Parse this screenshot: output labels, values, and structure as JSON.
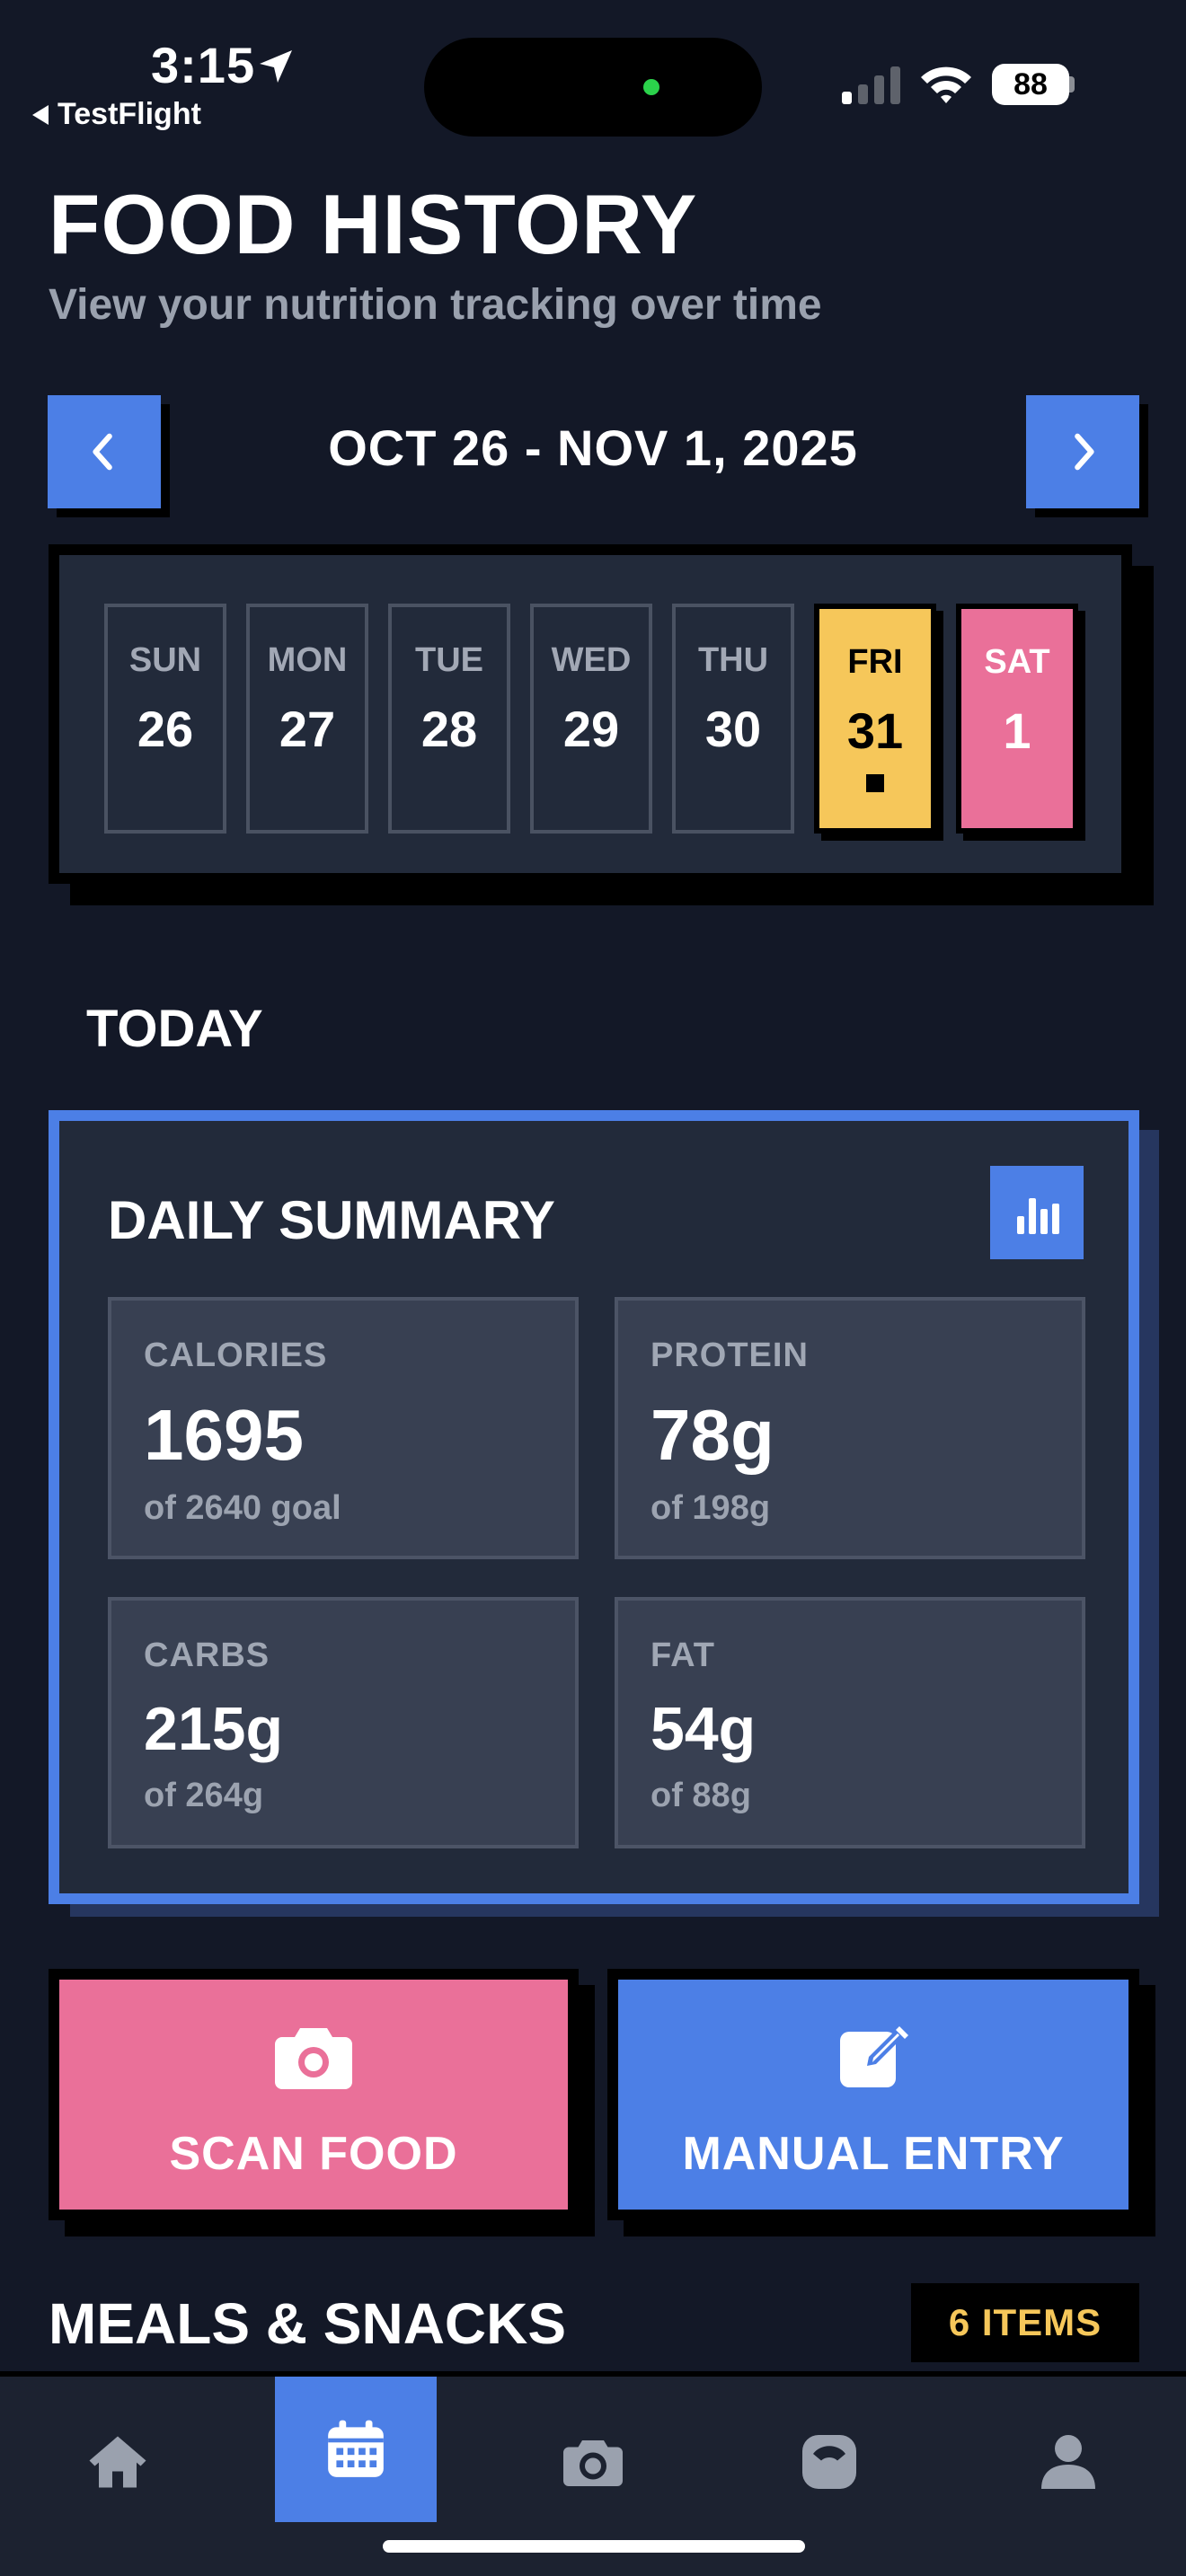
{
  "status_bar": {
    "time": "3:15",
    "back_app": "TestFlight",
    "battery": "88"
  },
  "header": {
    "title": "FOOD HISTORY",
    "subtitle": "View your nutrition tracking over time"
  },
  "week": {
    "range": "OCT 26 - NOV 1, 2025",
    "days": [
      {
        "name": "SUN",
        "num": "26"
      },
      {
        "name": "MON",
        "num": "27"
      },
      {
        "name": "TUE",
        "num": "28"
      },
      {
        "name": "WED",
        "num": "29"
      },
      {
        "name": "THU",
        "num": "30"
      },
      {
        "name": "FRI",
        "num": "31"
      },
      {
        "name": "SAT",
        "num": "1"
      }
    ]
  },
  "section_label": "TODAY",
  "summary": {
    "title": "DAILY SUMMARY",
    "stats": [
      {
        "label": "CALORIES",
        "value": "1695",
        "goal": "of 2640 goal"
      },
      {
        "label": "PROTEIN",
        "value": "78g",
        "goal": "of 198g"
      },
      {
        "label": "CARBS",
        "value": "215g",
        "goal": "of 264g"
      },
      {
        "label": "FAT",
        "value": "54g",
        "goal": "of 88g"
      }
    ]
  },
  "actions": {
    "scan_label": "SCAN FOOD",
    "manual_label": "MANUAL ENTRY"
  },
  "meals": {
    "title": "MEALS & SNACKS",
    "count": "6 ITEMS"
  },
  "tabs": [
    "home-icon",
    "calendar-icon",
    "camera-icon",
    "scale-icon",
    "profile-icon"
  ],
  "colors": {
    "background": "#131827",
    "accent_blue": "#4c7fe6",
    "accent_yellow": "#f6c75a",
    "accent_pink": "#ea7099"
  }
}
